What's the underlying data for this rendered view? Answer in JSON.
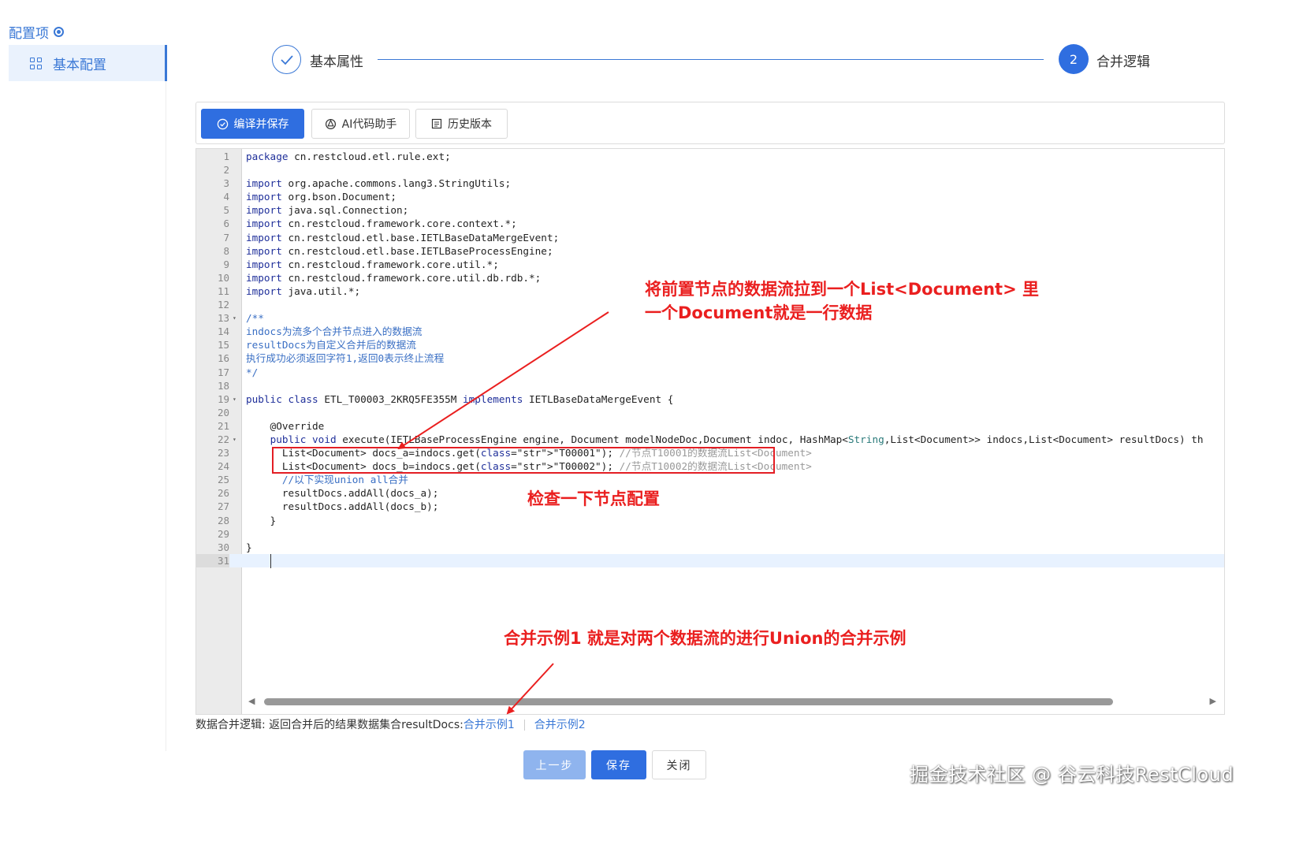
{
  "sidebar": {
    "title": "配置项",
    "items": [
      {
        "label": "基本配置",
        "icon": "grid-icon"
      }
    ]
  },
  "steps": [
    {
      "label": "基本属性",
      "status": "done",
      "icon": "check-icon"
    },
    {
      "label": "合并逻辑",
      "status": "active",
      "number": "2"
    }
  ],
  "toolbar": {
    "compile_label": "编译并保存",
    "ai_label": "AI代码助手",
    "history_label": "历史版本"
  },
  "editor": {
    "lines": [
      "package cn.restcloud.etl.rule.ext;",
      "",
      "import org.apache.commons.lang3.StringUtils;",
      "import org.bson.Document;",
      "import java.sql.Connection;",
      "import cn.restcloud.framework.core.context.*;",
      "import cn.restcloud.etl.base.IETLBaseDataMergeEvent;",
      "import cn.restcloud.etl.base.IETLBaseProcessEngine;",
      "import cn.restcloud.framework.core.util.*;",
      "import cn.restcloud.framework.core.util.db.rdb.*;",
      "import java.util.*;",
      "",
      "/**",
      "indocs为流多个合并节点进入的数据流",
      "resultDocs为自定义合并后的数据流",
      "执行成功必须返回字符1,返回0表示终止流程",
      "*/",
      "",
      "public class ETL_T00003_2KRQ5FE355M implements IETLBaseDataMergeEvent {",
      "",
      "    @Override",
      "    public void execute(IETLBaseProcessEngine engine, Document modelNodeDoc,Document indoc, HashMap<String,List<Document>> indocs,List<Document> resultDocs) th",
      "      List<Document> docs_a=indocs.get(\"T00001\"); //节点T10001的数据流List<Document>",
      "      List<Document> docs_b=indocs.get(\"T00002\"); //节点T10002的数据流List<Document>",
      "      //以下实现union all合并",
      "      resultDocs.addAll(docs_a);",
      "      resultDocs.addAll(docs_b);",
      "    }",
      "",
      "}",
      ""
    ]
  },
  "hint": {
    "prefix": "数据合并逻辑: 返回合并后的结果数据集合resultDocs:",
    "link1": "合并示例1",
    "link2": "合并示例2"
  },
  "buttons": {
    "prev": "上一步",
    "save": "保存",
    "close": "关闭"
  },
  "annotations": {
    "top_line1": "将前置节点的数据流拉到一个List<Document> 里",
    "top_line2": "一个Document就是一行数据",
    "middle": "检查一下节点配置",
    "bottom": "合并示例1 就是对两个数据流的进行Union的合并示例",
    "color": "#ea1f1f"
  },
  "watermark": "掘金技术社区 @ 谷云科技RestCloud",
  "colors": {
    "accent": "#2f6ee0",
    "sidebar_active_bg": "#eaf2fd"
  }
}
